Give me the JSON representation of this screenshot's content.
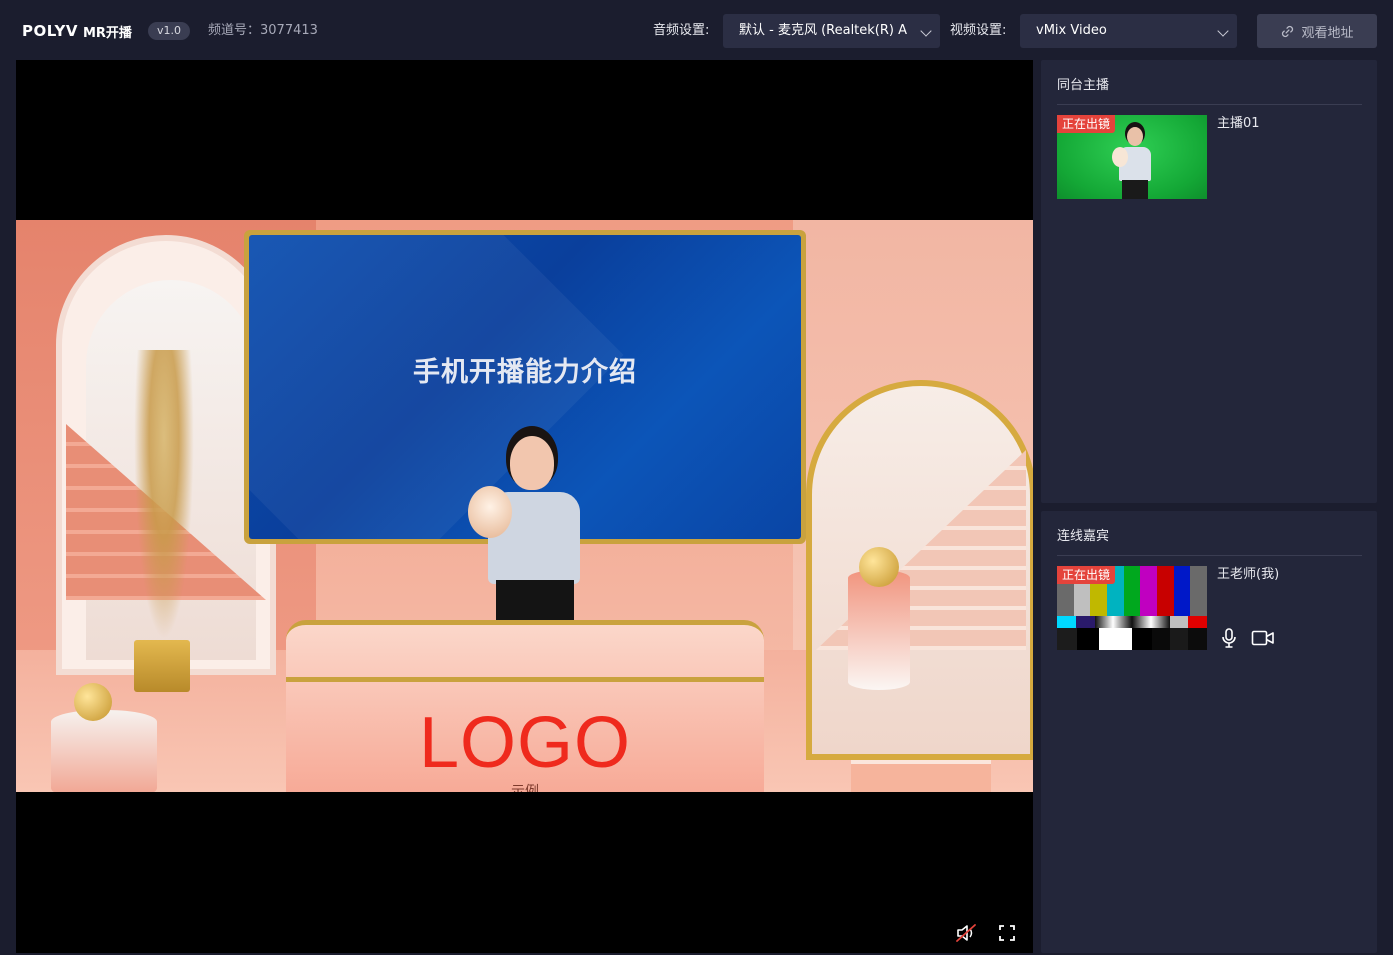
{
  "header": {
    "brand_mark": "POLYV",
    "brand_name": "MR开播",
    "version": "v1.0",
    "channel": "频道号：3077413",
    "audio_label": "音频设置:",
    "audio_value": "默认 - 麦克风 (Realtek(R) A",
    "video_label": "视频设置:",
    "video_value": "vMix Video",
    "watch_button": "观看地址"
  },
  "stage": {
    "screen_title": "手机开播能力介绍",
    "desk_logo": "LOGO",
    "desk_sub": "示例",
    "controls": {
      "mute_icon": "speaker-muted-icon",
      "fullscreen_icon": "fullscreen-icon"
    }
  },
  "co_hosts": {
    "title": "同台主播",
    "items": [
      {
        "badge": "正在出镜",
        "name": "主播01"
      }
    ]
  },
  "guests": {
    "title": "连线嘉宾",
    "items": [
      {
        "badge": "正在出镜",
        "name": "王老师(我)"
      }
    ]
  },
  "colors": {
    "background": "#1b1d2e",
    "panel": "#23263a",
    "select": "#2b2e44",
    "badge": "#e4433b",
    "logo_red": "#ef2a1d"
  }
}
